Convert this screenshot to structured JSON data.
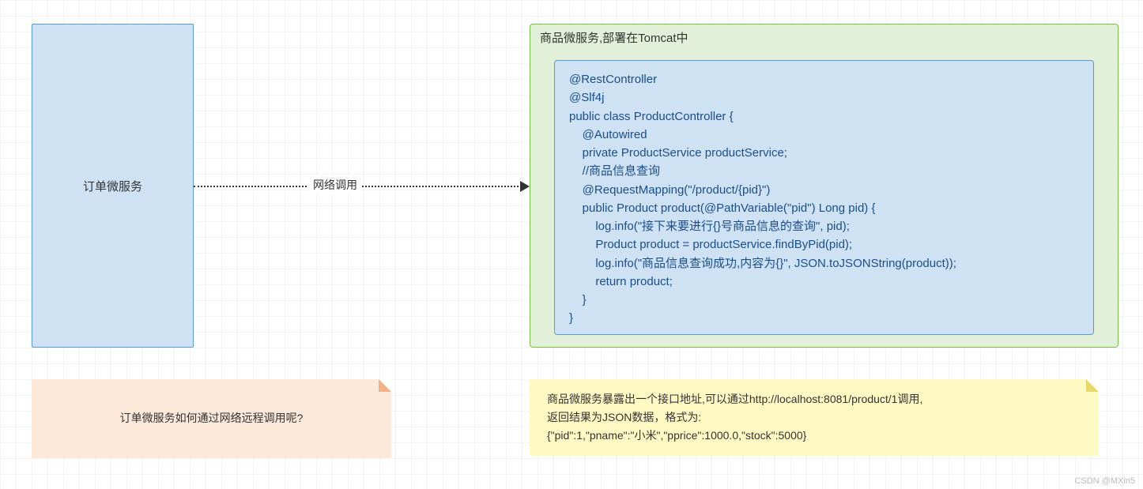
{
  "orderService": {
    "label": "订单微服务"
  },
  "arrow": {
    "label": "网络调用"
  },
  "productService": {
    "outerTitle": "商品微服务,部署在Tomcat中",
    "code": "@RestController\n@Slf4j\npublic class ProductController {\n    @Autowired\n    private ProductService productService;\n    //商品信息查询\n    @RequestMapping(\"/product/{pid}\")\n    public Product product(@PathVariable(\"pid\") Long pid) {\n        log.info(\"接下来要进行{}号商品信息的查询\", pid);\n        Product product = productService.findByPid(pid);\n        log.info(\"商品信息查询成功,内容为{}\", JSON.toJSONString(product));\n        return product;\n    }\n}"
  },
  "noteLeft": {
    "text": "订单微服务如何通过网络远程调用呢?"
  },
  "noteRight": {
    "text": "商品微服务暴露出一个接口地址,可以通过http://localhost:8081/product/1调用,\n返回结果为JSON数据，格式为:\n{\"pid\":1,\"pname\":\"小米\",\"pprice\":1000.0,\"stock\":5000}"
  },
  "watermark": "CSDN @MXin5"
}
